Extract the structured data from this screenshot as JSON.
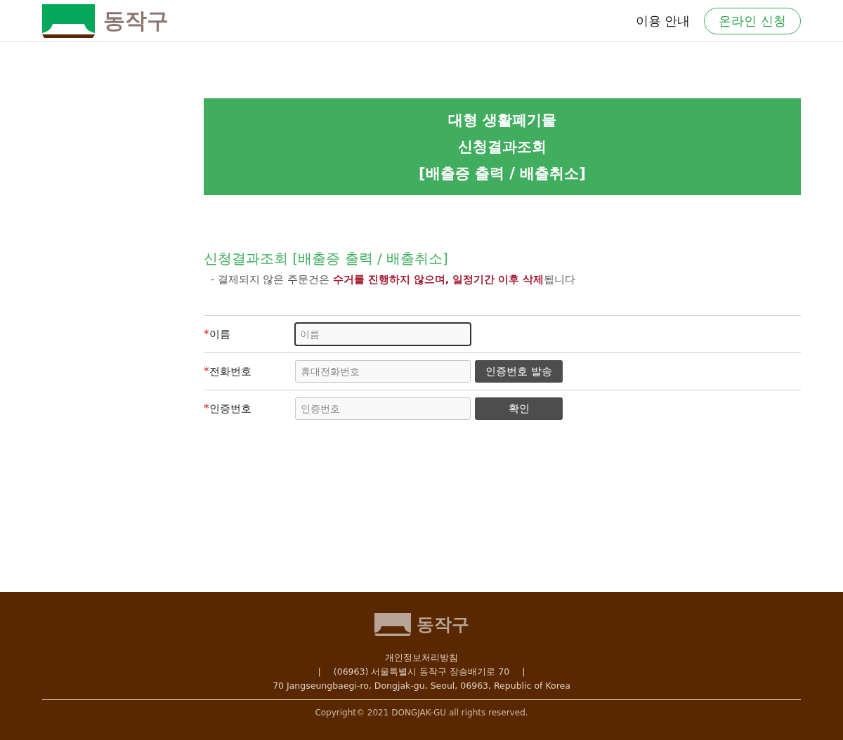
{
  "header": {
    "logo": {
      "text": "동작구"
    },
    "nav": [
      {
        "label": "이용 안내",
        "kind": "link"
      },
      {
        "label": "온라인 신청",
        "kind": "button"
      }
    ]
  },
  "banner": {
    "lines": [
      "대형 생활폐기물",
      "신청결과조회",
      "[배출증 출력 / 배출취소]"
    ]
  },
  "section": {
    "title": "신청결과조회 [배출증 출력 / 배출취소]",
    "notice": "- 결제되지 않은 주문건은 **수거를 진행하지 않으며, 일정기간 이후 삭제**됩니다"
  },
  "form": {
    "rows": [
      {
        "required_mark": "*",
        "label": "이름",
        "placeholder": "이름",
        "focused": true
      },
      {
        "required_mark": "*",
        "label": "전화번호",
        "placeholder": "휴대전화번호",
        "focused": false,
        "button": "인증번호 발송"
      },
      {
        "required_mark": "*",
        "label": "인증번호",
        "placeholder": "인증번호",
        "focused": false,
        "button": "확인"
      }
    ]
  },
  "footer": {
    "logo": {
      "text": "동작구"
    },
    "policy_link": "개인정보처리방침",
    "separator_left": "|",
    "address_ko": "(06963) 서울특별시 동작구 장승배기로 70",
    "separator_right": "|",
    "address_en": "70 Jangseungbaegi-ro, Dongjak-gu, Seoul, 06963, Republic of Korea",
    "copyright": "Copyright© 2021 DONGJAK-GU all rights reserved."
  }
}
